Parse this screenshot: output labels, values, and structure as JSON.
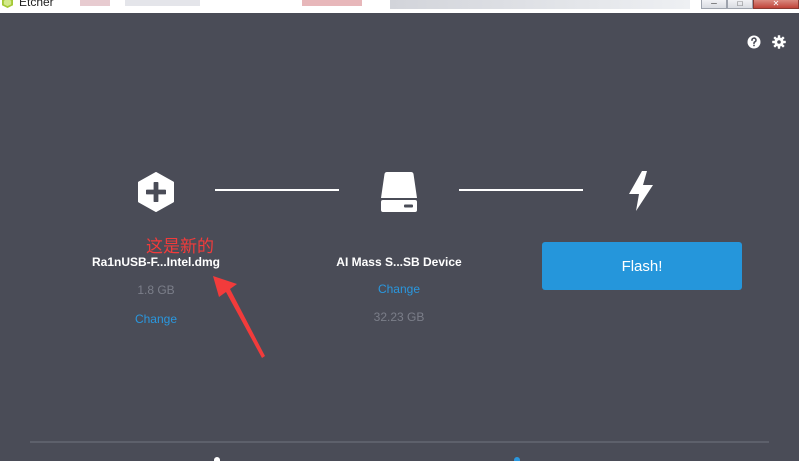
{
  "window": {
    "title": "Etcher",
    "minimize_glyph": "─",
    "maximize_glyph": "□",
    "close_glyph": "✕"
  },
  "header": {
    "help_icon": "help-circle-icon",
    "settings_icon": "gear-icon"
  },
  "steps": {
    "image": {
      "icon": "plus-hexagon-icon",
      "name": "Ra1nUSB-F...Intel.dmg",
      "size": "1.8 GB",
      "change_label": "Change"
    },
    "drive": {
      "icon": "drive-icon",
      "name": "AI Mass S...SB Device",
      "change_label": "Change",
      "size": "32.23 GB"
    },
    "flash": {
      "icon": "lightning-icon",
      "button_label": "Flash!"
    }
  },
  "annotation": {
    "text": "这是新的"
  },
  "colors": {
    "background": "#4a4c57",
    "accent": "#2596db",
    "link": "#2a97de",
    "muted_text": "#7b7e89",
    "annotation": "#f23b3b"
  }
}
